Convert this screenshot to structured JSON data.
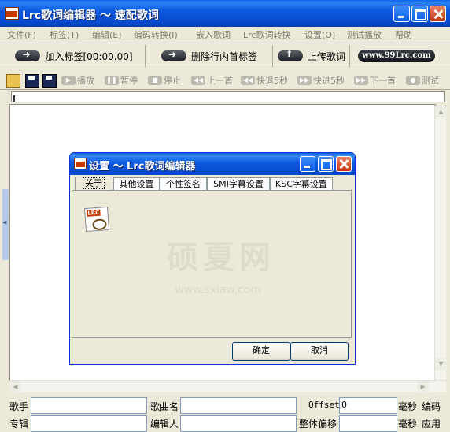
{
  "app": {
    "title": "Lrc歌词编辑器 ～ 速配歌词"
  },
  "menu": [
    "文件(F)",
    "标签(T)",
    "编辑(E)",
    "编码转换(I)",
    "嵌入歌词",
    "Lrc歌词转换",
    "设置(O)",
    "测试播放",
    "帮助"
  ],
  "toolbar": {
    "add_tag": "加入标签[00:00.00]",
    "delete_tag": "删除行内首标签",
    "upload": "上传歌词",
    "site": "www.99Lrc.com"
  },
  "media": [
    "播放",
    "暂停",
    "停止",
    "上一首",
    "快退5秒",
    "快进5秒",
    "下一首",
    "测试"
  ],
  "fields": {
    "singer_label": "歌手",
    "song_label": "歌曲名",
    "offset_label": "Offset",
    "offset_value": "0",
    "ms_label_1": "毫秒",
    "encode_label": "编码",
    "album_label": "专辑",
    "editor_label": "编辑人",
    "overall_offset_label": "整体偏移",
    "ms_label_2": "毫秒",
    "apply_label": "应用"
  },
  "dialog": {
    "title": "设置 ～ Lrc歌词编辑器",
    "tabs": [
      "关于",
      "其他设置",
      "个性签名",
      "SMI字幕设置",
      "KSC字幕设置"
    ],
    "active_tab": "关于",
    "watermark": "硕夏网",
    "watermark_url": "www.sxiaw.com",
    "ok": "确定",
    "cancel": "取消"
  },
  "colors": {
    "title_bar": "#0a5fe8",
    "window_bg": "#ece9d8",
    "close_button": "#c5360d"
  },
  "icons": [
    "app-lrc-icon",
    "minimize-icon",
    "maximize-icon",
    "close-icon",
    "arrow-right-icon",
    "arrow-up-icon",
    "open-folder-icon",
    "save-icon",
    "save-as-icon",
    "lrc-about-icon"
  ]
}
